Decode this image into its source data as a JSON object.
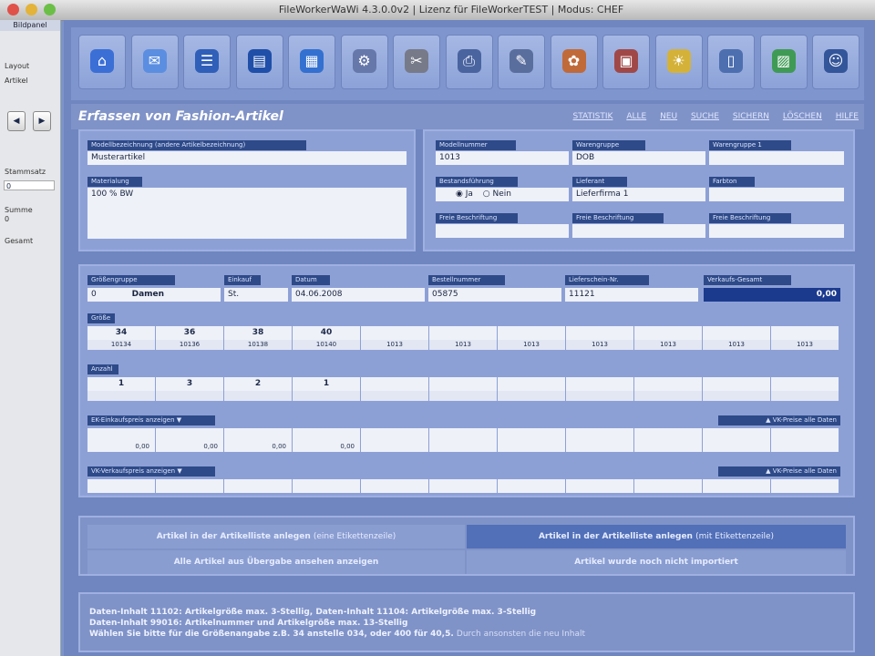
{
  "window": {
    "title": "FileWorkerWaWi 4.3.0.0v2 | Lizenz für FileWorkerTEST | Modus: CHEF"
  },
  "left_panel": {
    "header": "Bildpanel",
    "labels": [
      "Layout",
      "Artikel",
      "Stammsatz",
      "Summe",
      "Gesamt"
    ],
    "values": [
      "",
      "",
      "0",
      "0",
      ""
    ]
  },
  "toolbar": {
    "icons": [
      "home-icon",
      "chat-icon",
      "stack-icon",
      "book-icon",
      "list-icon",
      "gear-icon",
      "tools-icon",
      "printer-icon",
      "edit-icon",
      "palette-icon",
      "box-icon",
      "bulb-icon",
      "document-icon",
      "image-icon",
      "users-icon"
    ]
  },
  "heading": {
    "title": "Erfassen von Fashion-Artikel",
    "links": [
      "STATISTIK",
      "ALLE",
      "NEU",
      "SUCHE",
      "SICHERN",
      "LÖSCHEN",
      "HILFE"
    ]
  },
  "top_left": {
    "name_label": "Modellbezeichnung (andere Artikelbezeichnung)",
    "name_value": "Musterartikel",
    "material_label": "Materialung",
    "material_value": "100 % BW"
  },
  "top_right": {
    "labels": [
      "Modellnummer",
      "Warengruppe",
      "Warengruppe 1",
      "Bestandsführung",
      "Lieferant",
      "Farbton",
      "Freie Beschriftung",
      "Freie Beschriftung",
      "Freie Beschriftung"
    ],
    "values": [
      "1013",
      "DOB",
      "",
      "",
      "Lieferfirma 1",
      "",
      "",
      "",
      ""
    ],
    "radio_yes": "Ja",
    "radio_no": "Nein"
  },
  "order": {
    "labels": [
      "Größengruppe",
      "Einkauf",
      "Datum",
      "Bestellnummer",
      "Lieferschein-Nr.",
      "Verkaufs-Gesamt"
    ],
    "values": [
      "0",
      "Damen",
      "St.",
      "04.06.2008",
      "05875",
      "11121",
      "0,00"
    ]
  },
  "sizes": {
    "label": "Größe",
    "values": [
      "34",
      "36",
      "38",
      "40",
      "",
      "",
      "",
      "",
      "",
      "",
      "",
      ""
    ],
    "codes": [
      "10134",
      "10136",
      "10138",
      "10140",
      "1013",
      "1013",
      "1013",
      "1013",
      "1013",
      "1013",
      "1013",
      "1013"
    ]
  },
  "quantity": {
    "label": "Anzahl",
    "values": [
      "1",
      "3",
      "2",
      "1",
      "",
      "",
      "",
      "",
      "",
      "",
      "",
      ""
    ]
  },
  "prices": {
    "label_left": "EK-Einkaufspreis anzeigen",
    "label_right": "VK-Preise alle Daten",
    "values": [
      "0,00",
      "0,00",
      "0,00",
      "0,00",
      "",
      "",
      "",
      "",
      "",
      "",
      "",
      ""
    ]
  },
  "vk": {
    "label_left": "VK-Verkaufspreis anzeigen",
    "label_right": "VK-Preise alle Daten"
  },
  "buttons": {
    "create_single": "Artikel in der Artikelliste anlegen",
    "create_single_hint": "(eine Etikettenzeile)",
    "create_all": "Artikel in der Artikelliste anlegen",
    "create_all_hint": "(mit Etikettenzeile)",
    "show_transfer": "Alle Artikel aus Übergabe ansehen anzeigen",
    "not_imported": "Artikel wurde noch nicht importiert"
  },
  "info": {
    "line1": "Daten-Inhalt 11102: Artikelgröße max. 3-Stellig, Daten-Inhalt 11104: Artikelgröße max. 3-Stellig",
    "line2": "Daten-Inhalt 99016: Artikelnummer und Artikelgröße max. 13-Stellig",
    "line3": "Wählen Sie bitte für die Größenangabe z.B. 34 anstelle 034, oder 400 für 40,5.",
    "line3_hint": "Durch ansonsten die neu Inhalt"
  },
  "colors": {
    "accent": "#1b3a8e",
    "panel": "#8da0d6",
    "background": "#6f86c0"
  }
}
